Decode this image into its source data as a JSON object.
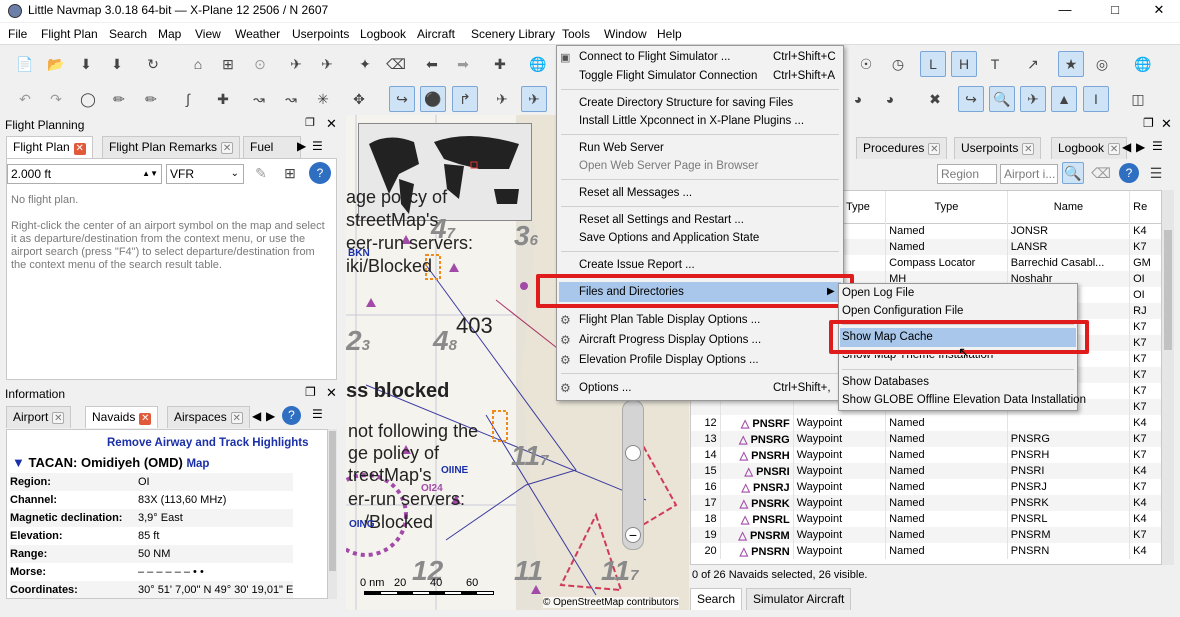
{
  "window": {
    "title": "Little Navmap 3.0.18 64-bit — X-Plane 12 2506 / N 2607"
  },
  "menubar": [
    "File",
    "Flight Plan",
    "Search",
    "Map",
    "View",
    "Weather",
    "Userpoints",
    "Logbook",
    "Aircraft",
    "Scenery Library",
    "Tools",
    "Window",
    "Help"
  ],
  "flight_planning": {
    "title": "Flight Planning",
    "tabs": [
      "Flight Plan",
      "Flight Plan Remarks",
      "Fuel Rep"
    ],
    "altitude": "2.000 ft",
    "rules": "VFR",
    "empty": "No flight plan.",
    "hint": "Right-click the center of an airport symbol on the map and select it as departure/destination from the context menu, or use the airport search (press \"F4\") to select departure/destination from the context menu of the search result table."
  },
  "information": {
    "title": "Information",
    "tabs": [
      "Airport",
      "Navaids",
      "Airspaces"
    ],
    "remove_link": "Remove Airway and Track Highlights",
    "heading": "TACAN: Omidiyeh (OMD)",
    "map_link": "Map",
    "rows": [
      {
        "k": "Region:",
        "v": "OI"
      },
      {
        "k": "Channel:",
        "v": "83X (113,60 MHz)"
      },
      {
        "k": "Magnetic declination:",
        "v": "3,9° East"
      },
      {
        "k": "Elevation:",
        "v": "85 ft"
      },
      {
        "k": "Range:",
        "v": "50 NM"
      },
      {
        "k": "Morse:",
        "v": "– – –   – –   – • •"
      },
      {
        "k": "Coordinates:",
        "v": "30° 51' 7,00\" N 49° 30' 19,01\" E"
      }
    ]
  },
  "map": {
    "texts": [
      "403",
      "ss blocked",
      "not following the",
      "ge policy of",
      "treetMap's",
      "er-run servers:",
      "/Blocked",
      "eer-run servers:",
      "iki/Blocked",
      "streetMap's",
      "age policy of"
    ],
    "labels": [
      "BKN",
      "OIINE",
      "OI24",
      "OING"
    ],
    "scale": {
      "labels": [
        "0 nm",
        "20",
        "40",
        "60"
      ]
    },
    "copyright": "© OpenStreetMap contributors"
  },
  "tools_menu": {
    "items": [
      {
        "label": "Connect to Flight Simulator ...",
        "shortcut": "Ctrl+Shift+C"
      },
      {
        "label": "Toggle Flight Simulator Connection",
        "shortcut": "Ctrl+Shift+A"
      },
      {
        "label": "Create Directory Structure for saving Files",
        "shortcut": ""
      },
      {
        "label": "Install Little Xpconnect in X-Plane Plugins ...",
        "shortcut": ""
      },
      {
        "label": "Run Web Server",
        "shortcut": ""
      },
      {
        "label": "Open Web Server Page in Browser",
        "shortcut": ""
      },
      {
        "label": "Reset all Messages ...",
        "shortcut": ""
      },
      {
        "label": "Reset all Settings and Restart ...",
        "shortcut": ""
      },
      {
        "label": "Save Options and Application State",
        "shortcut": ""
      },
      {
        "label": "Create Issue Report ...",
        "shortcut": ""
      },
      {
        "label": "Files and Directories",
        "shortcut": ""
      },
      {
        "label": "Flight Plan Table Display Options ...",
        "shortcut": ""
      },
      {
        "label": "Aircraft Progress Display Options ...",
        "shortcut": ""
      },
      {
        "label": "Elevation Profile Display Options ...",
        "shortcut": ""
      },
      {
        "label": "Options ...",
        "shortcut": "Ctrl+Shift+,"
      }
    ]
  },
  "files_submenu": {
    "items": [
      "Open Log File",
      "Open Configuration File",
      "Show Map Cache",
      "Show Map Theme Installation",
      "Show Databases",
      "Show GLOBE Offline Elevation Data Installation"
    ]
  },
  "search_panel": {
    "tabs": [
      "Procedures",
      "Userpoints",
      "Logbook"
    ],
    "region_placeholder": "Region",
    "airport_placeholder": "Airport i...",
    "columns": [
      "Navaid Type",
      "Type",
      "Name",
      "Re"
    ],
    "rows": [
      {
        "n": "",
        "ident": "",
        "ntype": "oint",
        "type": "Named",
        "name": "JONSR",
        "re": "K4"
      },
      {
        "n": "",
        "ident": "",
        "ntype": "oint",
        "type": "Named",
        "name": "LANSR",
        "re": "K7"
      },
      {
        "n": "",
        "ident": "",
        "ntype": "",
        "type": "Compass Locator",
        "name": "Barrechid Casabl...",
        "re": "GM"
      },
      {
        "n": "",
        "ident": "",
        "ntype": "",
        "type": "MH",
        "name": "Noshahr",
        "re": "OI"
      },
      {
        "n": "",
        "ident": "",
        "ntype": "",
        "type": "",
        "name": "",
        "re": "OI"
      },
      {
        "n": "",
        "ident": "",
        "ntype": "",
        "type": "",
        "name": "",
        "re": "RJ"
      },
      {
        "n": "",
        "ident": "",
        "ntype": "",
        "type": "",
        "name": "",
        "re": "K7"
      },
      {
        "n": "",
        "ident": "",
        "ntype": "",
        "type": "",
        "name": "",
        "re": "K7"
      },
      {
        "n": "",
        "ident": "",
        "ntype": "",
        "type": "",
        "name": "",
        "re": "K7"
      },
      {
        "n": "",
        "ident": "",
        "ntype": "",
        "type": "",
        "name": "",
        "re": "K7"
      },
      {
        "n": "",
        "ident": "",
        "ntype": "",
        "type": "",
        "name": "",
        "re": "K7"
      },
      {
        "n": "",
        "ident": "",
        "ntype": "",
        "type": "",
        "name": "",
        "re": "K7"
      },
      {
        "n": "12",
        "ident": "PNSRF",
        "ntype": "Waypoint",
        "type": "Named",
        "name": "",
        "re": "K4"
      },
      {
        "n": "13",
        "ident": "PNSRG",
        "ntype": "Waypoint",
        "type": "Named",
        "name": "PNSRG",
        "re": "K7"
      },
      {
        "n": "14",
        "ident": "PNSRH",
        "ntype": "Waypoint",
        "type": "Named",
        "name": "PNSRH",
        "re": "K7"
      },
      {
        "n": "15",
        "ident": "PNSRI",
        "ntype": "Waypoint",
        "type": "Named",
        "name": "PNSRI",
        "re": "K4"
      },
      {
        "n": "16",
        "ident": "PNSRJ",
        "ntype": "Waypoint",
        "type": "Named",
        "name": "PNSRJ",
        "re": "K7"
      },
      {
        "n": "17",
        "ident": "PNSRK",
        "ntype": "Waypoint",
        "type": "Named",
        "name": "PNSRK",
        "re": "K4"
      },
      {
        "n": "18",
        "ident": "PNSRL",
        "ntype": "Waypoint",
        "type": "Named",
        "name": "PNSRL",
        "re": "K4"
      },
      {
        "n": "19",
        "ident": "PNSRM",
        "ntype": "Waypoint",
        "type": "Named",
        "name": "PNSRM",
        "re": "K7"
      },
      {
        "n": "20",
        "ident": "PNSRN",
        "ntype": "Waypoint",
        "type": "Named",
        "name": "PNSRN",
        "re": "K4"
      }
    ],
    "status": "0 of 26 Navaids selected, 26 visible.",
    "bottom_tabs": [
      "Search",
      "Simulator Aircraft"
    ]
  }
}
